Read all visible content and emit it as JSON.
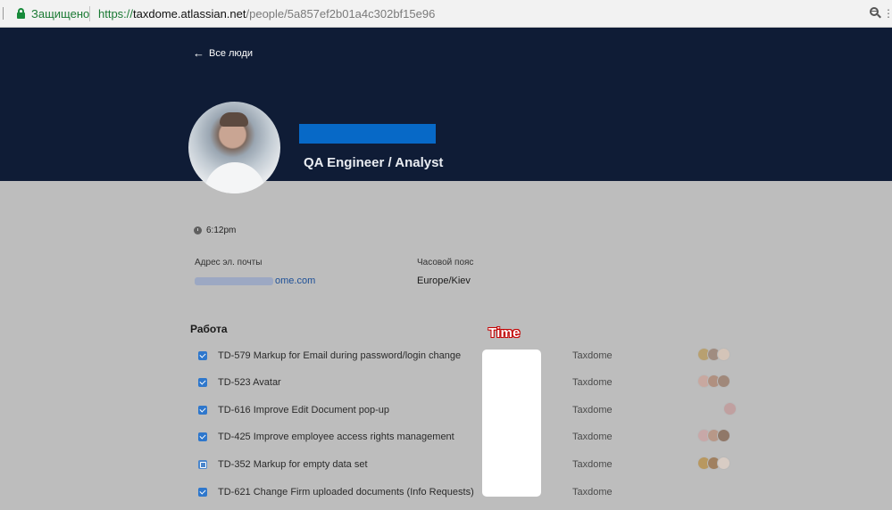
{
  "browser": {
    "secure_label": "Защищено",
    "url_scheme": "https://",
    "url_host": "taxdome.atlassian.net",
    "url_path": "/people/5a857ef2b01a4c302bf15e96"
  },
  "header": {
    "back_label": "Все люди",
    "role": "QA Engineer / Analyst"
  },
  "profile": {
    "local_time": "6:12pm",
    "email_label": "Адрес эл. почты",
    "email_visible_suffix": "ome.com",
    "timezone_label": "Часовой пояс",
    "timezone_value": "Europe/Kiev"
  },
  "work": {
    "title": "Работа",
    "annotation": "Time",
    "items": [
      {
        "issue": "TD-579 Markup for Email during password/login change",
        "project": "Taxdome",
        "icon": "task-checkbox-icon",
        "avatars": [
          "#b8a070",
          "#a08c80",
          "#d4c4b8"
        ]
      },
      {
        "issue": "TD-523 Avatar",
        "project": "Taxdome",
        "icon": "task-checkbox-icon",
        "avatars": [
          "#c8a8a0",
          "#b09080",
          "#a0887a"
        ]
      },
      {
        "issue": "TD-616 Improve Edit Document pop-up",
        "project": "Taxdome",
        "icon": "task-checkbox-icon",
        "avatars": [
          "#c0a0a0"
        ]
      },
      {
        "issue": "TD-425 Improve employee access rights management",
        "project": "Taxdome",
        "icon": "task-checkbox-icon",
        "avatars": [
          "#c8a8a8",
          "#b89888",
          "#907868"
        ]
      },
      {
        "issue": "TD-352 Markup for empty data set",
        "project": "Taxdome",
        "icon": "story-icon",
        "avatars": [
          "#b89860",
          "#a08060",
          "#d8ccc4"
        ]
      },
      {
        "issue": "TD-621 Change Firm uploaded documents (Info Requests)",
        "project": "Taxdome",
        "icon": "task-checkbox-icon",
        "avatars": []
      }
    ]
  }
}
